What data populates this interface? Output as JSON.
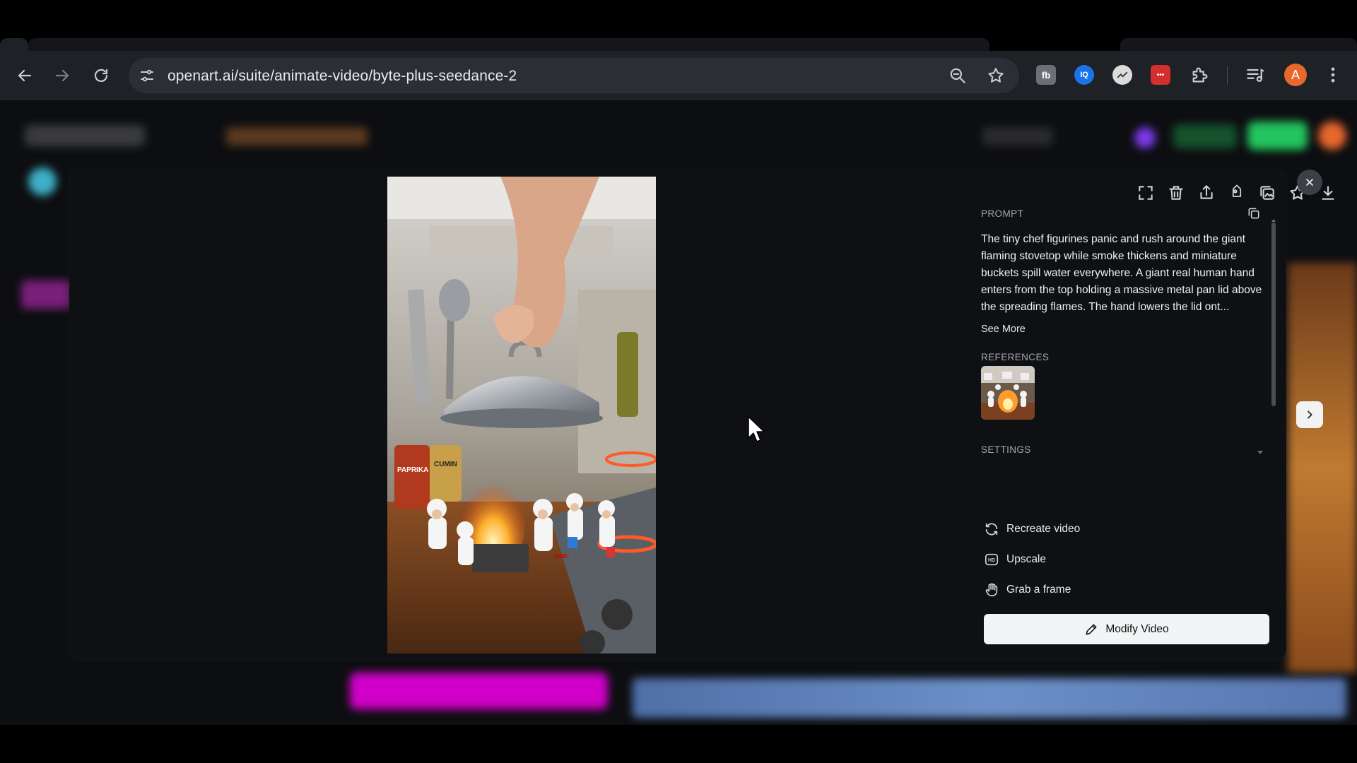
{
  "browser": {
    "url": "openart.ai/suite/animate-video/byte-plus-seedance-2",
    "profile_initial": "A",
    "extensions": [
      {
        "name": "fb-extension",
        "label": "fb",
        "color": "#6b6f76"
      },
      {
        "name": "iq-extension",
        "label": "IQ",
        "color": "#1a73e8"
      },
      {
        "name": "chart-extension",
        "label": "",
        "color": "#dcdcdc"
      },
      {
        "name": "dots-extension",
        "label": "•••",
        "color": "#d32f2f"
      }
    ]
  },
  "modal": {
    "prompt_label": "PROMPT",
    "prompt_text": "The tiny chef figurines panic and rush around the giant flaming stovetop while smoke thickens and miniature buckets spill water everywhere. A giant real human hand enters from the top holding a massive metal pan lid above the spreading flames. The hand lowers the lid ont...",
    "see_more": "See More",
    "references_label": "REFERENCES",
    "settings_label": "SETTINGS",
    "menu": {
      "recreate": "Recreate video",
      "upscale": "Upscale",
      "grab_frame": "Grab a frame"
    },
    "modify_button": "Modify Video",
    "image_labels": {
      "paprika": "PAPRIKA",
      "cumin": "CUMIN",
      "fire": "FIRE!"
    },
    "upscale_badge": "HD"
  },
  "colors": {
    "modal_bg": "#0e1013",
    "accent_pink": "#d100c8",
    "accent_green": "#22c55e",
    "button_bg": "#f3f4f6"
  }
}
